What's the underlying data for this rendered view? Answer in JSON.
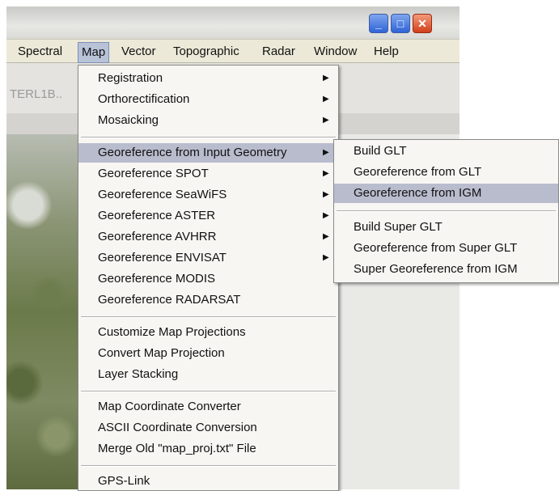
{
  "menubar": {
    "items": [
      "Spectral",
      "Map",
      "Vector",
      "Topographic",
      "Radar",
      "Window",
      "Help"
    ],
    "active": "Map"
  },
  "window_controls": {
    "minimize": "_",
    "maximize": "□",
    "close": "✕"
  },
  "file_tab": "TERL1B..",
  "map_menu": {
    "groups": [
      [
        "Registration",
        "Orthorectification",
        "Mosaicking"
      ],
      [
        "Georeference from Input Geometry",
        "Georeference SPOT",
        "Georeference SeaWiFS",
        "Georeference ASTER",
        "Georeference AVHRR",
        "Georeference ENVISAT",
        "Georeference MODIS",
        "Georeference RADARSAT"
      ],
      [
        "Customize Map Projections",
        "Convert Map Projection",
        "Layer Stacking"
      ],
      [
        "Map Coordinate Converter",
        "ASCII Coordinate Conversion",
        "Merge Old \"map_proj.txt\" File"
      ],
      [
        "GPS-Link"
      ]
    ],
    "highlighted": "Georeference from Input Geometry"
  },
  "submenu": {
    "groups": [
      [
        "Build GLT",
        "Georeference from GLT",
        "Georeference from IGM"
      ],
      [
        "Build Super GLT",
        "Georeference from Super GLT",
        "Super Georeference from IGM"
      ]
    ],
    "highlighted": "Georeference from IGM"
  },
  "icons": {
    "submenu_arrow": "submenu-arrow-icon"
  },
  "colors": {
    "highlight": "#b9bccd",
    "menubar": "#ece9d8",
    "menu_bg": "#f7f6f3"
  }
}
